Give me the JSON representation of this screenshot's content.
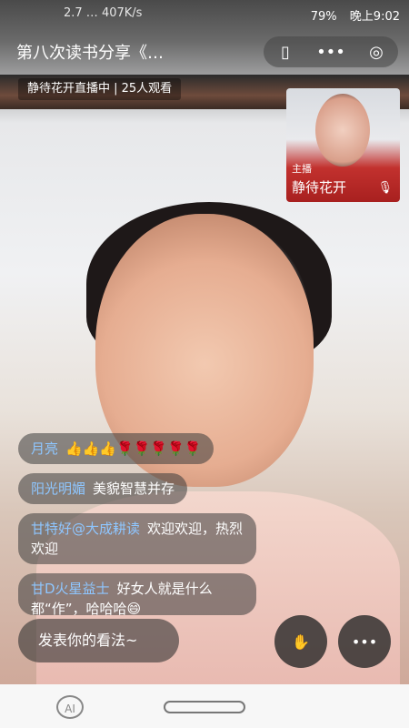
{
  "status": {
    "left": "2.7 … 407K/s",
    "time": "晚上9:02",
    "battery": "79%"
  },
  "header": {
    "title": "第八次读书分享《…",
    "viewer_info": "静待花开直播中 | 25人观看"
  },
  "pip": {
    "tag": "主播",
    "name": "静待花开"
  },
  "chat": [
    {
      "nick": "月亮",
      "text": "👍👍👍🌹🌹🌹🌹🌹"
    },
    {
      "nick": "阳光明媚",
      "text": "美貌智慧并存"
    },
    {
      "nick": "甘特好@大成耕读",
      "text": "欢迎欢迎，热烈欢迎"
    },
    {
      "nick": "甘D火星益士",
      "text": "好女人就是什么都“作”，哈哈哈😄"
    }
  ],
  "input": {
    "placeholder": "发表你的看法~"
  },
  "icons": {
    "menu": "more-icon",
    "mini": "minimize-icon",
    "close": "close-icon",
    "profile": "profile-icon",
    "hand": "hand-icon"
  },
  "colors": {
    "nickname": "#8ec6ff",
    "pip_bg": "#c2312e"
  }
}
